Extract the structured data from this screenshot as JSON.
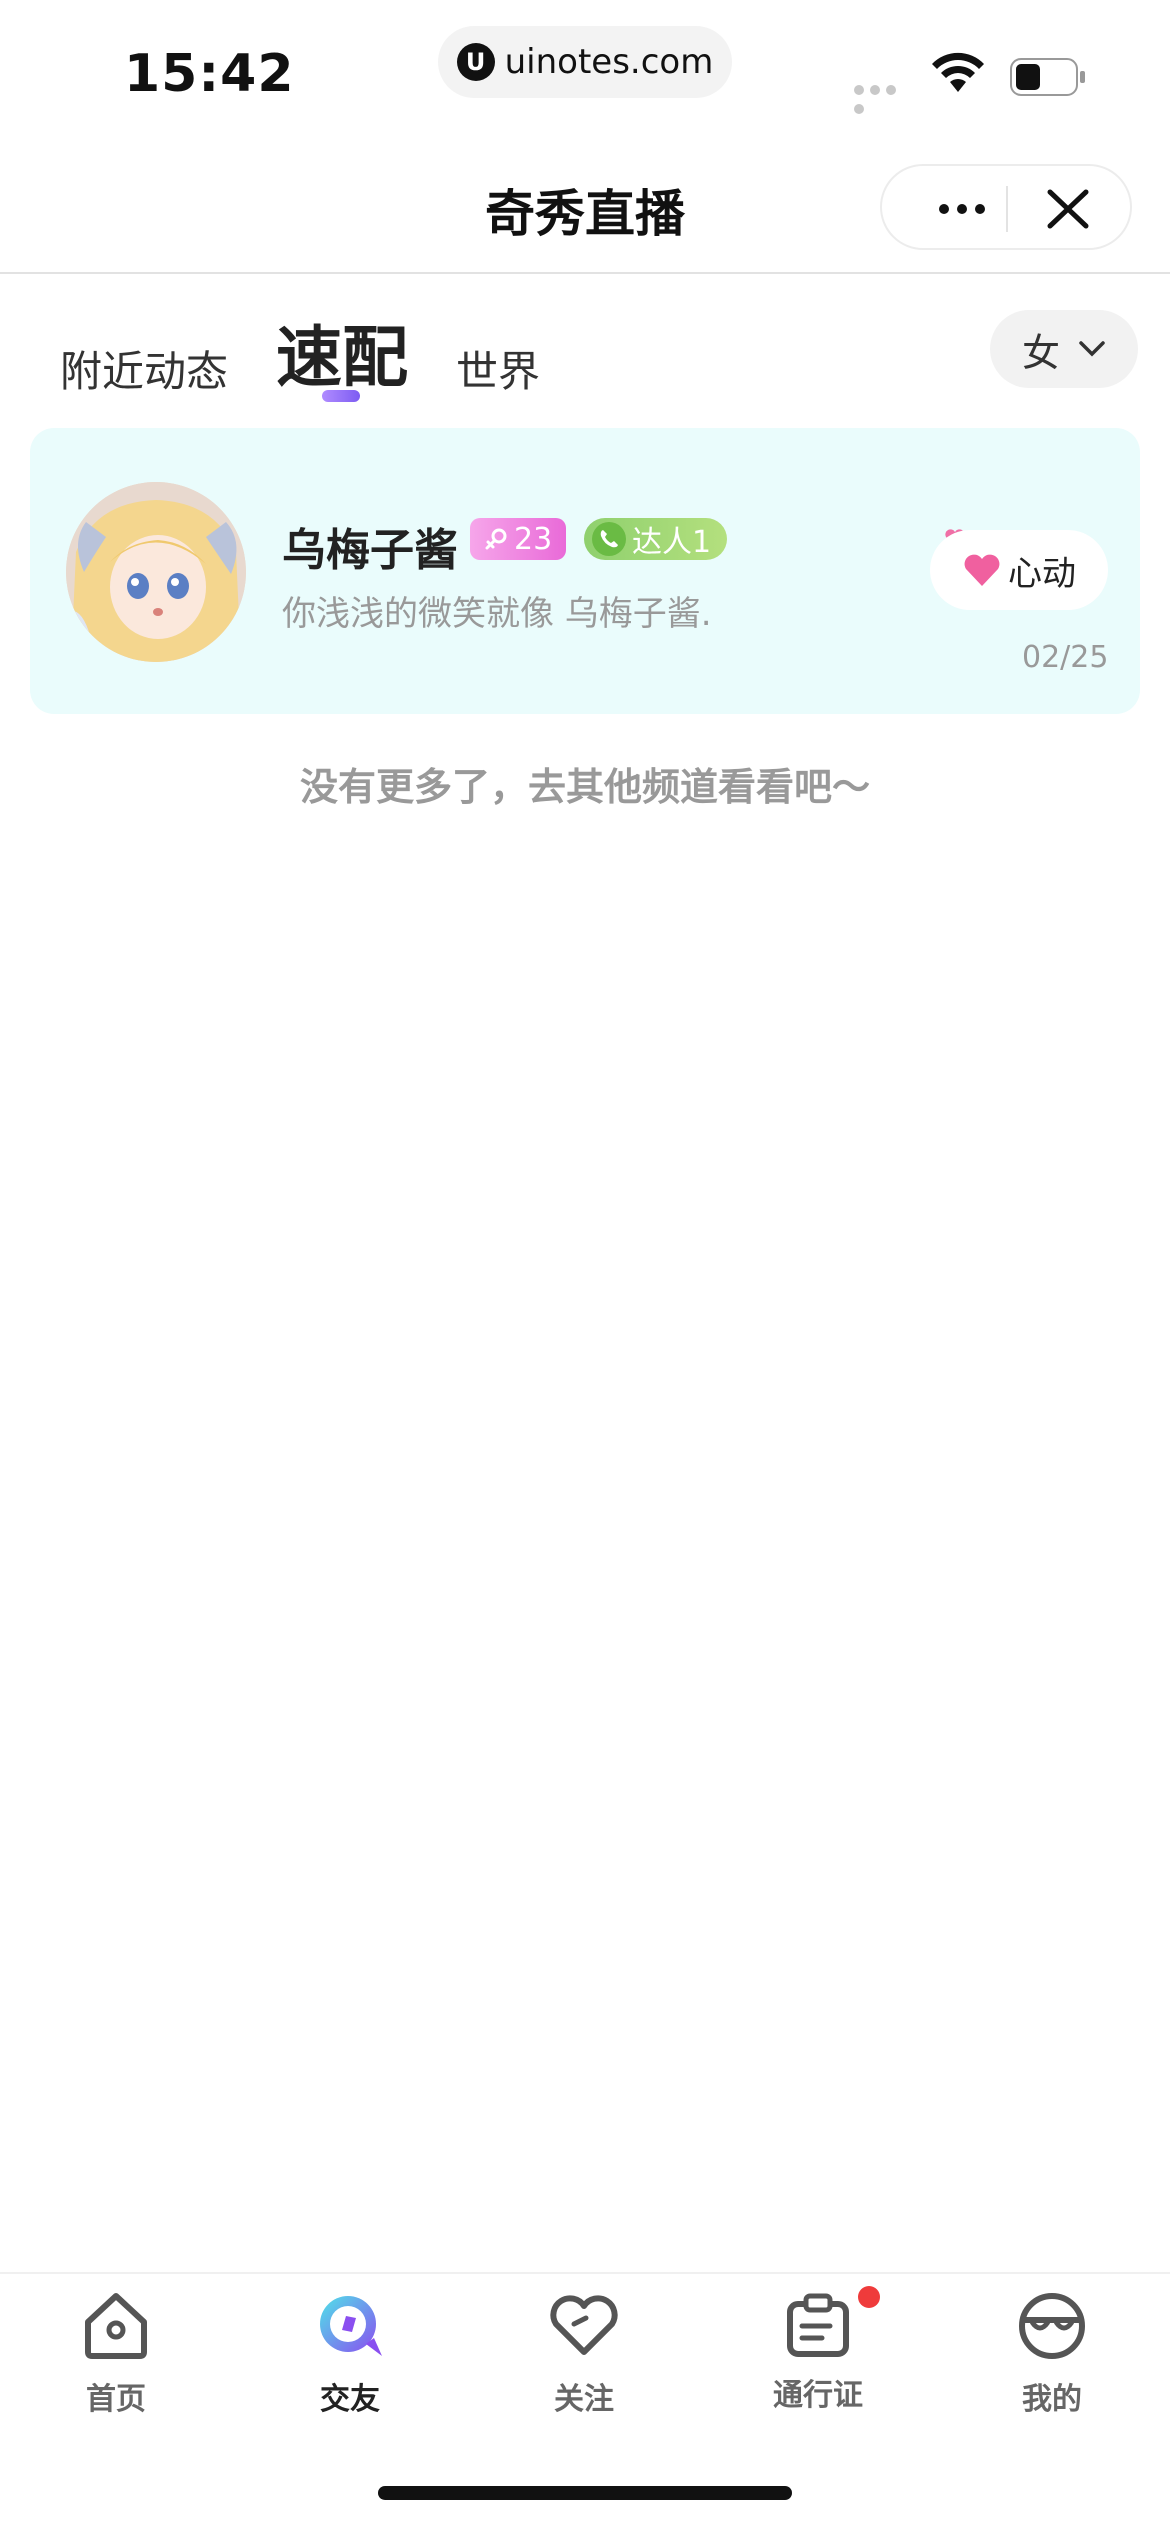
{
  "status_bar": {
    "time": "15:42",
    "url": "uinotes.com",
    "url_icon_glyph": "U"
  },
  "header": {
    "title": "奇秀直播",
    "more_icon": "more-dots-icon",
    "close_icon": "close-icon"
  },
  "tabs": {
    "items": [
      {
        "label": "附近动态",
        "active": false
      },
      {
        "label": "速配",
        "active": true
      },
      {
        "label": "世界",
        "active": false
      }
    ],
    "gender_filter": "女"
  },
  "card": {
    "nickname": "乌梅子酱",
    "age": "23",
    "talent": "达人1",
    "bio": "你浅浅的微笑就像 乌梅子酱.",
    "action_label": "心动",
    "date": "02/25",
    "background_color": "#eafcfc"
  },
  "footer_note": "没有更多了，去其他频道看看吧～",
  "tabbar": {
    "items": [
      {
        "label": "首页",
        "icon": "home-icon",
        "active": false
      },
      {
        "label": "交友",
        "icon": "friends-chat-icon",
        "active": true
      },
      {
        "label": "关注",
        "icon": "heart-outline-icon",
        "active": false
      },
      {
        "label": "通行证",
        "icon": "pass-icon",
        "active": false,
        "badge": true
      },
      {
        "label": "我的",
        "icon": "profile-face-icon",
        "active": false
      }
    ]
  },
  "colors": {
    "accent_purple": "#7d5cf2",
    "badge_pink": "#e96ad8",
    "badge_green": "#8fd06e",
    "notice_red": "#ef3b3b"
  }
}
